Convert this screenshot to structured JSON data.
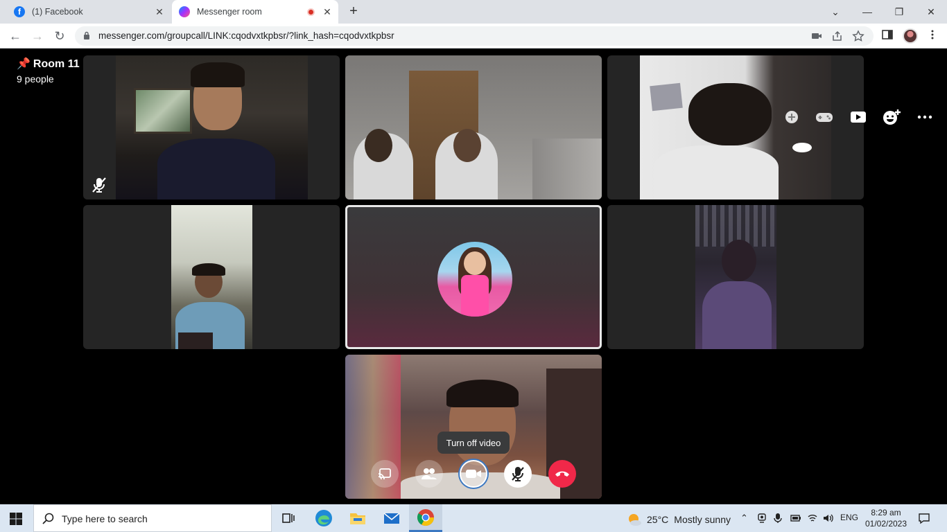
{
  "browser": {
    "tabs": [
      {
        "title": "(1) Facebook",
        "close": "✕"
      },
      {
        "title": "Messenger room",
        "close": "✕"
      }
    ],
    "new_tab": "+",
    "url": "messenger.com/groupcall/LINK:cqodvxtkpbsr/?link_hash=cqodvxtkpbsr",
    "window_controls": {
      "minimize": "—",
      "restore": "❐",
      "close": "✕",
      "tab_list": "⌄"
    }
  },
  "room": {
    "title": "Room 11",
    "people": "9 people"
  },
  "call": {
    "tooltip": "Turn off video",
    "controls": [
      "share-screen-icon",
      "people-icon",
      "video-camera-icon",
      "microphone-muted-icon",
      "end-call-icon"
    ],
    "top_icons": [
      "add-icon",
      "game-controller-icon",
      "watch-together-icon",
      "add-reaction-icon",
      "more-options-icon"
    ]
  },
  "taskbar": {
    "search_placeholder": "Type here to search",
    "weather": {
      "temp": "25°C",
      "condition": "Mostly sunny"
    },
    "language": "ENG",
    "time": "8:29 am",
    "date": "01/02/2023"
  },
  "colors": {
    "end_call": "#f02849",
    "accent": "#3b78c2"
  }
}
